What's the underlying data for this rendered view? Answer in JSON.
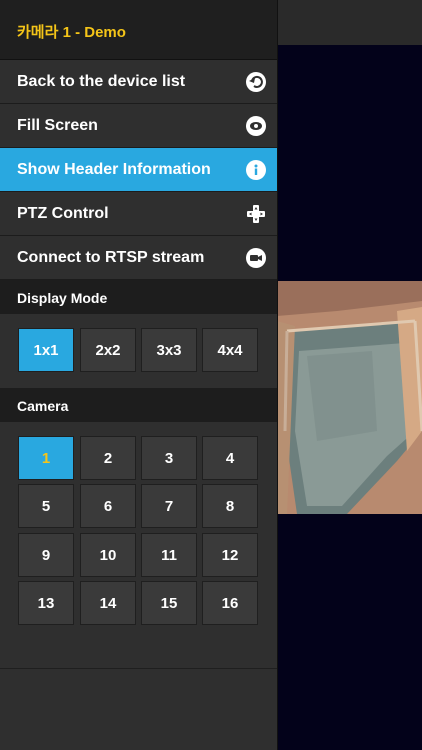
{
  "drawer": {
    "title": "카메라 1 - Demo",
    "menu": [
      {
        "label": "Back to the device list",
        "icon": "back-arrow-icon"
      },
      {
        "label": "Fill Screen",
        "icon": "eye-icon"
      },
      {
        "label": "Show Header Information",
        "icon": "info-icon",
        "active": true
      },
      {
        "label": "PTZ Control",
        "icon": "dpad-icon"
      },
      {
        "label": "Connect to RTSP stream",
        "icon": "video-camera-icon"
      }
    ]
  },
  "display_mode": {
    "label": "Display Mode",
    "options": [
      "1x1",
      "2x2",
      "3x3",
      "4x4"
    ],
    "selected": "1x1"
  },
  "camera": {
    "label": "Camera",
    "numbers": [
      "1",
      "2",
      "3",
      "4",
      "5",
      "6",
      "7",
      "8",
      "9",
      "10",
      "11",
      "12",
      "13",
      "14",
      "15",
      "16"
    ],
    "selected": "1"
  },
  "colors": {
    "accent_blue": "#29a8e0",
    "title_yellow": "#f5c518",
    "panel": "#2f2f2f",
    "video_background": "#03021a"
  }
}
